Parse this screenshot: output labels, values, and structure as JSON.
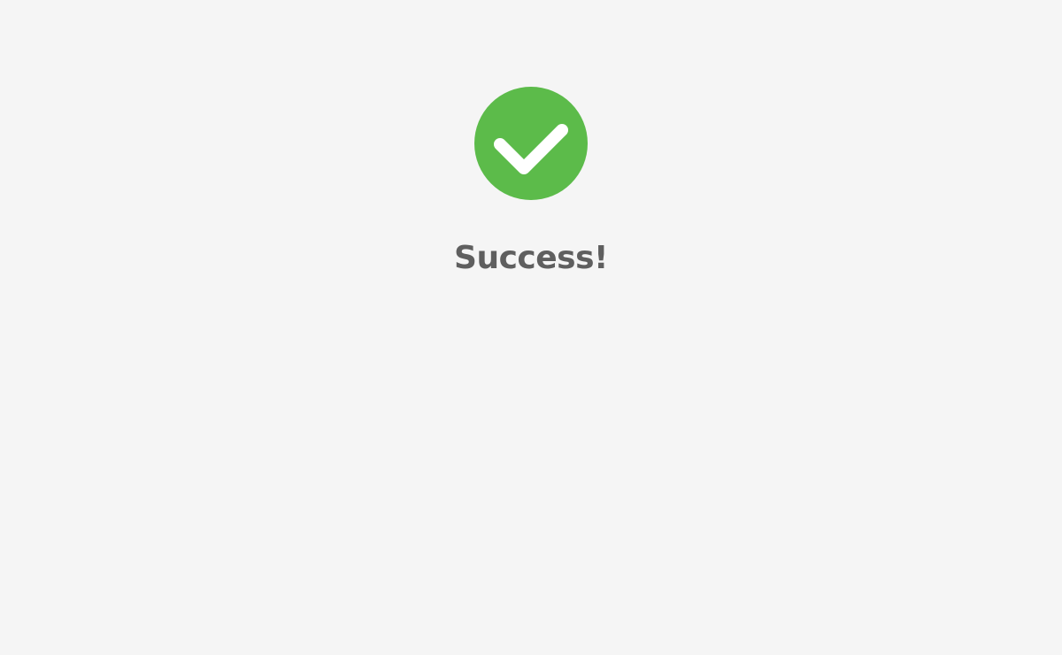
{
  "status": {
    "icon": "checkmark-circle-icon",
    "icon_color": "#5cbb4a",
    "title": "Success!",
    "title_color": "#5f5f5f",
    "background_color": "#f5f5f5"
  }
}
